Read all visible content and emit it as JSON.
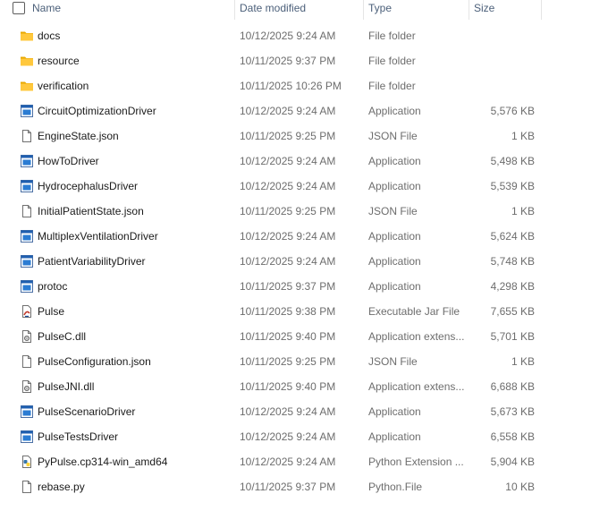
{
  "header": {
    "name": "Name",
    "date": "Date modified",
    "type": "Type",
    "size": "Size"
  },
  "files": [
    {
      "name": "docs",
      "date": "10/12/2025 9:24 AM",
      "type": "File folder",
      "size": "",
      "icon": "folder-icon"
    },
    {
      "name": "resource",
      "date": "10/11/2025 9:37 PM",
      "type": "File folder",
      "size": "",
      "icon": "folder-icon"
    },
    {
      "name": "verification",
      "date": "10/11/2025 10:26 PM",
      "type": "File folder",
      "size": "",
      "icon": "folder-icon"
    },
    {
      "name": "CircuitOptimizationDriver",
      "date": "10/12/2025 9:24 AM",
      "type": "Application",
      "size": "5,576 KB",
      "icon": "application-icon"
    },
    {
      "name": "EngineState.json",
      "date": "10/11/2025 9:25 PM",
      "type": "JSON File",
      "size": "1 KB",
      "icon": "file-icon"
    },
    {
      "name": "HowToDriver",
      "date": "10/12/2025 9:24 AM",
      "type": "Application",
      "size": "5,498 KB",
      "icon": "application-icon"
    },
    {
      "name": "HydrocephalusDriver",
      "date": "10/12/2025 9:24 AM",
      "type": "Application",
      "size": "5,539 KB",
      "icon": "application-icon"
    },
    {
      "name": "InitialPatientState.json",
      "date": "10/11/2025 9:25 PM",
      "type": "JSON File",
      "size": "1 KB",
      "icon": "file-icon"
    },
    {
      "name": "MultiplexVentilationDriver",
      "date": "10/12/2025 9:24 AM",
      "type": "Application",
      "size": "5,624 KB",
      "icon": "application-icon"
    },
    {
      "name": "PatientVariabilityDriver",
      "date": "10/12/2025 9:24 AM",
      "type": "Application",
      "size": "5,748 KB",
      "icon": "application-icon"
    },
    {
      "name": "protoc",
      "date": "10/11/2025 9:37 PM",
      "type": "Application",
      "size": "4,298 KB",
      "icon": "application-icon"
    },
    {
      "name": "Pulse",
      "date": "10/11/2025 9:38 PM",
      "type": "Executable Jar File",
      "size": "7,655 KB",
      "icon": "jar-icon"
    },
    {
      "name": "PulseC.dll",
      "date": "10/11/2025 9:40 PM",
      "type": "Application extens...",
      "size": "5,701 KB",
      "icon": "dll-icon"
    },
    {
      "name": "PulseConfiguration.json",
      "date": "10/11/2025 9:25 PM",
      "type": "JSON File",
      "size": "1 KB",
      "icon": "file-icon"
    },
    {
      "name": "PulseJNI.dll",
      "date": "10/11/2025 9:40 PM",
      "type": "Application extens...",
      "size": "6,688 KB",
      "icon": "dll-icon"
    },
    {
      "name": "PulseScenarioDriver",
      "date": "10/12/2025 9:24 AM",
      "type": "Application",
      "size": "5,673 KB",
      "icon": "application-icon"
    },
    {
      "name": "PulseTestsDriver",
      "date": "10/12/2025 9:24 AM",
      "type": "Application",
      "size": "6,558 KB",
      "icon": "application-icon"
    },
    {
      "name": "PyPulse.cp314-win_amd64",
      "date": "10/12/2025 9:24 AM",
      "type": "Python Extension ...",
      "size": "5,904 KB",
      "icon": "python-icon"
    },
    {
      "name": "rebase.py",
      "date": "10/11/2025 9:37 PM",
      "type": "Python.File",
      "size": "10 KB",
      "icon": "file-icon"
    }
  ]
}
